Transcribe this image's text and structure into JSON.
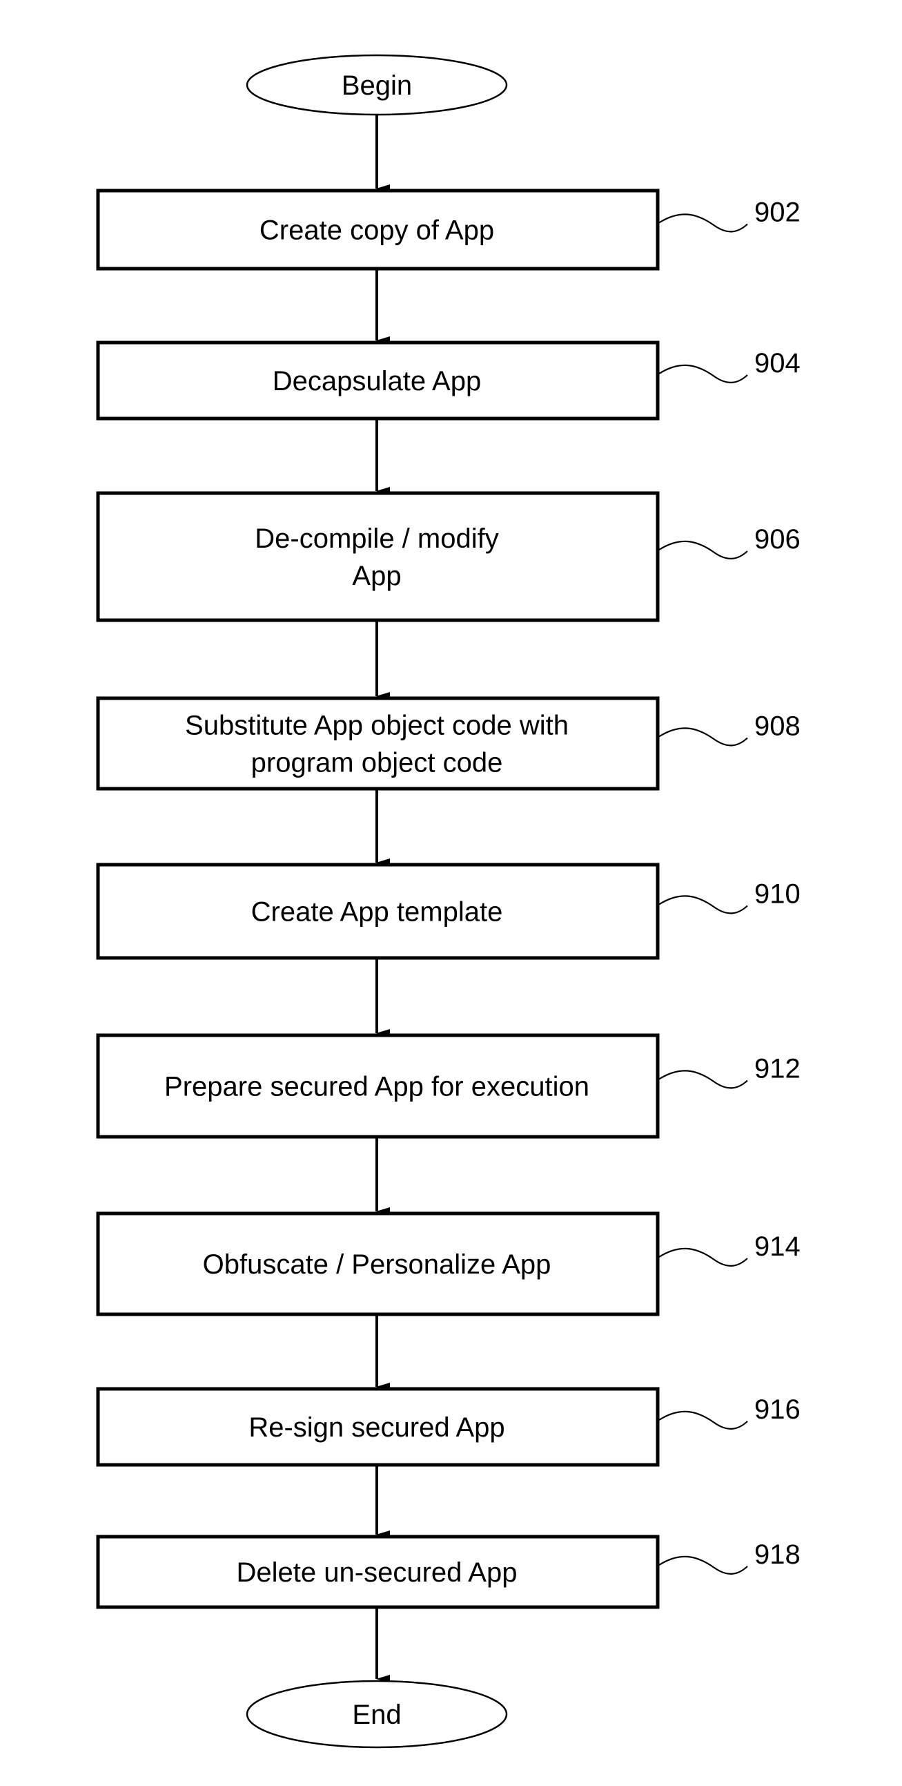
{
  "diagram": {
    "type": "flowchart",
    "direction": "top-to-bottom",
    "nodes": [
      {
        "id": "begin",
        "shape": "terminator",
        "lines": [
          "Begin"
        ],
        "ref": ""
      },
      {
        "id": "902",
        "shape": "process",
        "lines": [
          "Create copy of App"
        ],
        "ref": "902"
      },
      {
        "id": "904",
        "shape": "process",
        "lines": [
          "Decapsulate App"
        ],
        "ref": "904"
      },
      {
        "id": "906",
        "shape": "process",
        "lines": [
          "De-compile / modify",
          "App"
        ],
        "ref": "906"
      },
      {
        "id": "908",
        "shape": "process",
        "lines": [
          "Substitute App object code with",
          "program object code"
        ],
        "ref": "908"
      },
      {
        "id": "910",
        "shape": "process",
        "lines": [
          "Create App template"
        ],
        "ref": "910"
      },
      {
        "id": "912",
        "shape": "process",
        "lines": [
          "Prepare secured App for execution"
        ],
        "ref": "912"
      },
      {
        "id": "914",
        "shape": "process",
        "lines": [
          "Obfuscate / Personalize App"
        ],
        "ref": "914"
      },
      {
        "id": "916",
        "shape": "process",
        "lines": [
          "Re-sign secured App"
        ],
        "ref": "916"
      },
      {
        "id": "918",
        "shape": "process",
        "lines": [
          "Delete un-secured App"
        ],
        "ref": "918"
      },
      {
        "id": "end",
        "shape": "terminator",
        "lines": [
          "End"
        ],
        "ref": ""
      }
    ],
    "edges": [
      [
        "begin",
        "902"
      ],
      [
        "902",
        "904"
      ],
      [
        "904",
        "906"
      ],
      [
        "906",
        "908"
      ],
      [
        "908",
        "910"
      ],
      [
        "910",
        "912"
      ],
      [
        "912",
        "914"
      ],
      [
        "914",
        "916"
      ],
      [
        "916",
        "918"
      ],
      [
        "918",
        "end"
      ]
    ]
  }
}
